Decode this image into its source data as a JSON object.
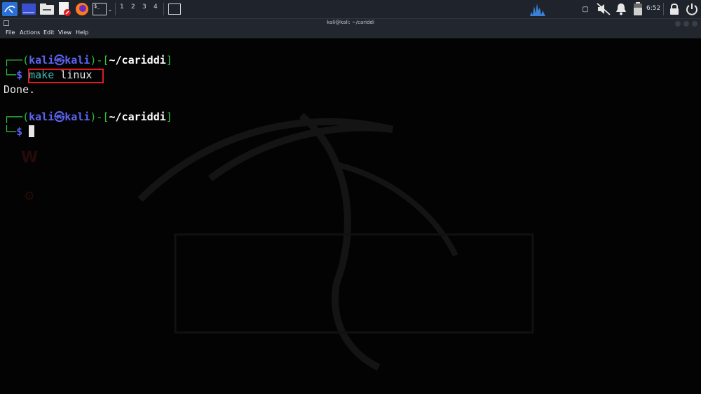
{
  "taskbar": {
    "workspaces": [
      "1",
      "2",
      "3",
      "4"
    ],
    "clock": "6:52",
    "terminal_icon_label": "$_"
  },
  "window": {
    "title": "kali@kali: ~/cariddi"
  },
  "menu": {
    "items": [
      "File",
      "Actions",
      "Edit",
      "View",
      "Help"
    ]
  },
  "terminal": {
    "prompt1": {
      "user": "kali",
      "host": "kali",
      "path": "~/cariddi",
      "command_prog": "make",
      "command_arg": "linux"
    },
    "output": "Done.",
    "prompt2": {
      "user": "kali",
      "host": "kali",
      "path": "~/cariddi"
    },
    "glyphs": {
      "top_left": "┌──(",
      "at": "㉿",
      "close_paren": ")-[",
      "close_bracket": "]",
      "bottom_left": "└─",
      "dollar": "$"
    }
  },
  "colors": {
    "prompt_frame": "#2fbf3c",
    "user_host": "#5b63f0",
    "command": "#3fb6b0",
    "highlight_box": "#e01b24",
    "taskbar_bg": "#1f232b"
  }
}
